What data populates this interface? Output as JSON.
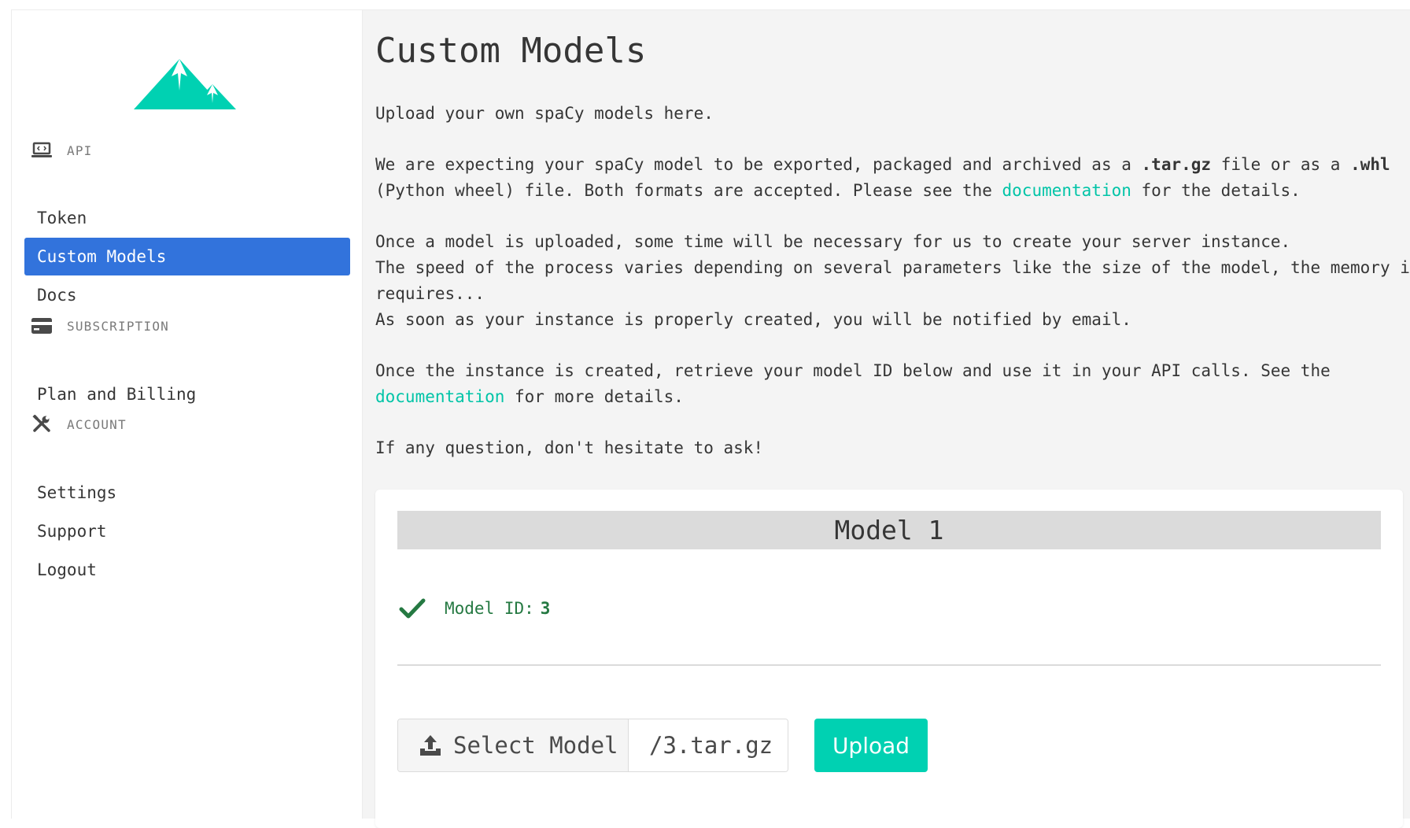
{
  "sidebar": {
    "sections": [
      {
        "label": "API",
        "icon": "laptop-code-icon"
      },
      {
        "label": "SUBSCRIPTION",
        "icon": "credit-card-icon"
      },
      {
        "label": "ACCOUNT",
        "icon": "tools-icon"
      }
    ],
    "items": [
      {
        "label": "Token",
        "active": false
      },
      {
        "label": "Custom Models",
        "active": true
      },
      {
        "label": "Docs",
        "active": false
      },
      {
        "label": "Plan and Billing",
        "active": false
      },
      {
        "label": "Settings",
        "active": false
      },
      {
        "label": "Support",
        "active": false
      },
      {
        "label": "Logout",
        "active": false
      }
    ]
  },
  "main": {
    "title": "Custom Models",
    "intro": "Upload your own spaCy models here.",
    "format": {
      "before": "We are expecting your spaCy model to be exported, packaged and archived as a ",
      "ext1": ".tar.gz",
      "middle": " file or as a ",
      "ext2": ".whl",
      "after": " (Python wheel) file. Both formats are accepted. Please see the ",
      "link": "documentation",
      "end": " for the details."
    },
    "process": {
      "line1": "Once a model is uploaded, some time will be necessary for us to create your server instance.",
      "line2": "The speed of the process varies depending on several parameters like the size of the model, the memory it requires...",
      "line3": "As soon as your instance is properly created, you will be notified by email."
    },
    "retrieve": {
      "before": "Once the instance is created, retrieve your model ID below and use it in your API calls. See the ",
      "link": "documentation",
      "after": " for more details."
    },
    "question": "If any question, don't hesitate to ask!"
  },
  "model_card": {
    "header": "Model 1",
    "id_label": "Model ID:",
    "id_value": "3",
    "select_label": "Select Model",
    "file_name": "/3.tar.gz",
    "upload_label": "Upload"
  },
  "colors": {
    "accent": "#00d1b2",
    "link": "#00c4a7",
    "active": "#3273dc",
    "success": "#257942"
  }
}
